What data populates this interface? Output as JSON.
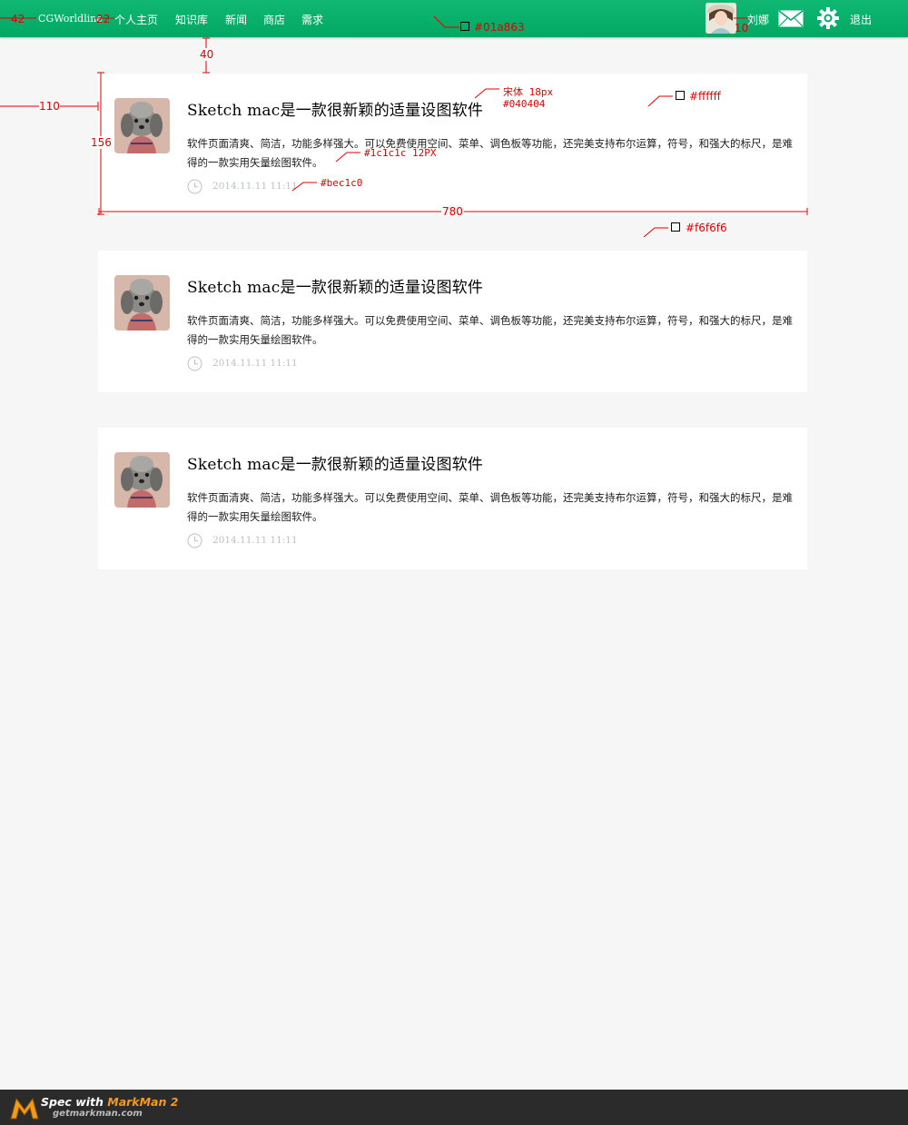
{
  "header": {
    "brand": "CGWorldline",
    "nav": [
      "个人主页",
      "知识库",
      "新闻",
      "商店",
      "需求"
    ],
    "user_name": "刘娜",
    "logout": "退出",
    "icons": [
      "avatar",
      "mail-icon",
      "gear-icon"
    ],
    "bg_color": "#01a863"
  },
  "articles": [
    {
      "title": "Sketch mac是一款很新颖的适量设图软件",
      "body": "软件页面清爽、简洁，功能多样强大。可以免费使用空间、菜单、调色板等功能，还完美支持布尔运算，符号，和强大的标尺，是难得的一款实用矢量绘图软件。",
      "time": "2014.11.11 11:11"
    },
    {
      "title": "Sketch mac是一款很新颖的适量设图软件",
      "body": "软件页面清爽、简洁，功能多样强大。可以免费使用空间、菜单、调色板等功能，还完美支持布尔运算，符号，和强大的标尺，是难得的一款实用矢量绘图软件。",
      "time": "2014.11.11 11:11"
    },
    {
      "title": "Sketch mac是一款很新颖的适量设图软件",
      "body": "软件页面清爽、简洁，功能多样强大。可以免费使用空间、菜单、调色板等功能，还完美支持布尔运算，符号，和强大的标尺，是难得的一款实用矢量绘图软件。",
      "time": "2014.11.11 11:11"
    }
  ],
  "annotations": {
    "brand_offset": "42",
    "nav_gap": "22",
    "header_color": "#01a863",
    "avatar_gap": "10",
    "top_gap": "40",
    "left_gap": "110",
    "card_height": "156",
    "card_width": "780",
    "title_font": "宋体  18px",
    "title_color": "#040404",
    "card_bg": "#ffffff",
    "body_font": "#1c1c1c  12PX",
    "time_color": "#bec1c0",
    "page_bg": "#f6f6f6"
  },
  "footer": {
    "spec_prefix": "Spec with ",
    "spec_brand": "MarkMan 2",
    "site": "getmarkman.com"
  }
}
